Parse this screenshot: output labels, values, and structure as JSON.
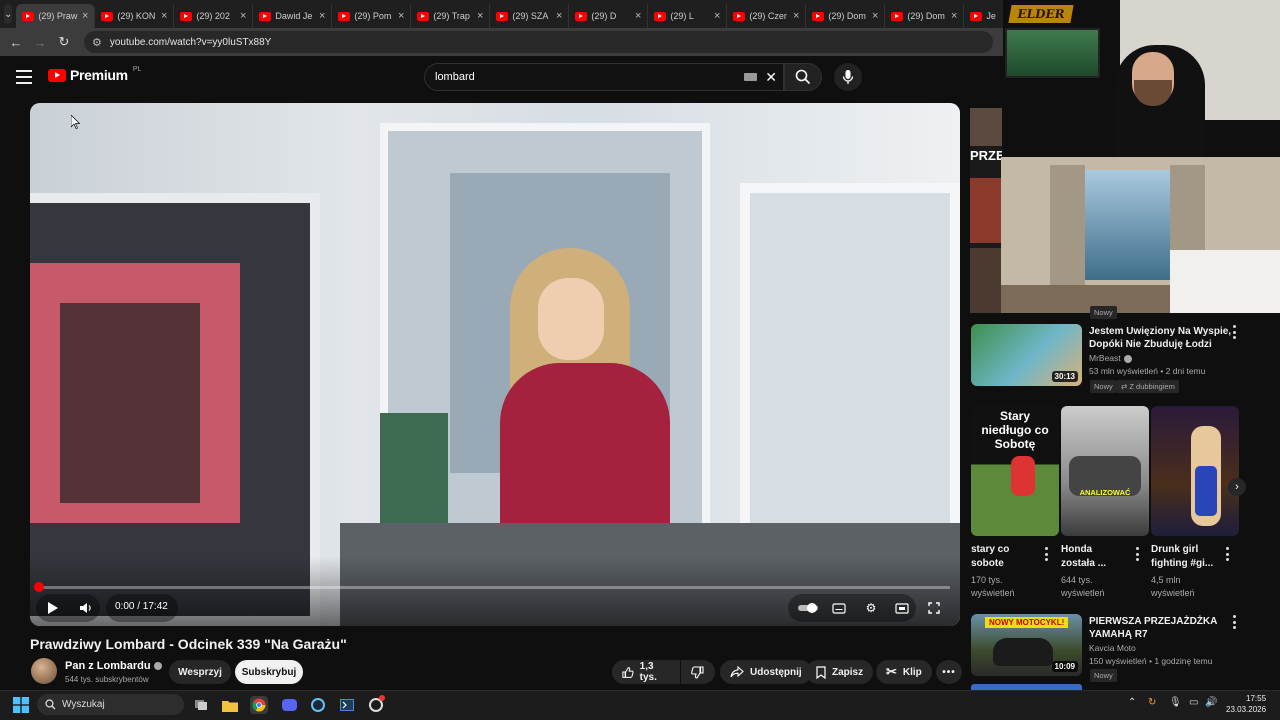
{
  "browser": {
    "tabs": [
      {
        "label": "(29) Praw"
      },
      {
        "label": "(29) KON"
      },
      {
        "label": "(29) 202"
      },
      {
        "label": "Dawid Je"
      },
      {
        "label": "(29) Pom"
      },
      {
        "label": "(29) Trap"
      },
      {
        "label": "(29) SZA"
      },
      {
        "label": "(29) D"
      },
      {
        "label": "(29) L"
      },
      {
        "label": "(29) Czer"
      },
      {
        "label": "(29) Dom"
      },
      {
        "label": "(29) Dom"
      },
      {
        "label": "Je"
      }
    ],
    "url": "youtube.com/watch?v=yy0luSTx88Y"
  },
  "youtube": {
    "logo_text": "Premium",
    "logo_region": "PL",
    "search_value": "lombard"
  },
  "player": {
    "time": "0:00 / 17:42",
    "progress": 0
  },
  "video": {
    "title": "Prawdziwy Lombard - Odcinek 339 \"Na Garażu\"",
    "channel": "Pan z Lombardu",
    "subscribers": "544 tys. subskrybentów",
    "support_label": "Wesprzyj",
    "subscribe_label": "Subskrybuj",
    "likes": "1,3 tys.",
    "share_label": "Udostępnij",
    "save_label": "Zapisz",
    "clip_label": "Klip"
  },
  "overlay": {
    "cam_logo": "ELDER",
    "strip_text": "PRZE"
  },
  "recommendations": [
    {
      "title_line1": "Jestem Uwięziony Na Wyspie,",
      "title_line2": "Dopóki Nie Zbuduję Łodzi",
      "channel": "MrBeast",
      "meta": "53 mln wyświetleń • 2 dni temu",
      "duration": "30:13",
      "badge_new": "Nowy",
      "badge_dub": "Z dubbingiem"
    },
    {
      "title_line1": "PIERWSZA PRZEJAŻDŻKA",
      "title_line2": "YAMAHĄ R7",
      "channel": "Kavcia Moto",
      "meta": "150 wyświetleń • 1 godzinę temu",
      "duration": "10:09",
      "badge_new": "Nowy",
      "thumb_text": "NOWY MOTOCYKL!"
    }
  ],
  "top_badge": "Nowy",
  "shorts": [
    {
      "overlay": "Stary niedługo co Sobotę",
      "title_line1": "stary co",
      "title_line2": "sobote",
      "views_line1": "170 tys.",
      "views_line2": "wyświetleń"
    },
    {
      "overlay": "ANALIZOWAĆ",
      "title_line1": "Honda",
      "title_line2": "została ...",
      "views_line1": "644 tys.",
      "views_line2": "wyświetleń"
    },
    {
      "overlay": "",
      "title_line1": "Drunk girl",
      "title_line2": "fighting #gi...",
      "views_line1": "4,5 mln",
      "views_line2": "wyświetleń"
    }
  ],
  "taskbar": {
    "search_placeholder": "Wyszukaj",
    "time": "17:55",
    "date": "23.03.2026"
  },
  "colors": {
    "accent": "#ff0000",
    "background": "#0f0f0f"
  }
}
